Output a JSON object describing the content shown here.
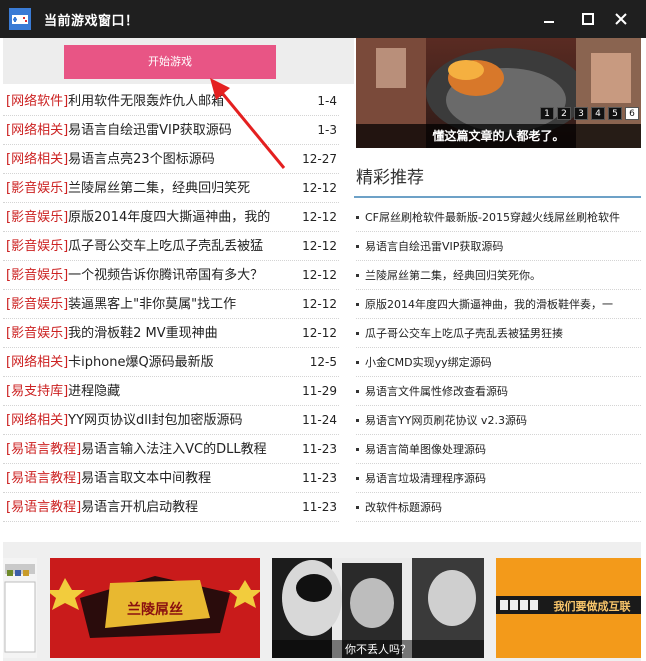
{
  "window": {
    "title": "当前游戏窗口！",
    "controls": {
      "minimize": "minimize",
      "maximize": "maximize",
      "close": "close"
    }
  },
  "start_button": {
    "label": "开始游戏"
  },
  "news": [
    {
      "tag": "[网络软件]",
      "title": "利用软件无限轰炸仇人邮箱",
      "date": "1-4"
    },
    {
      "tag": "[网络相关]",
      "title": "易语言自绘迅雷VIP获取源码",
      "date": "1-3"
    },
    {
      "tag": "[网络相关]",
      "title": "易语言点亮23个图标源码",
      "date": "12-27"
    },
    {
      "tag": "[影音娱乐]",
      "title": "兰陵屌丝第二集，经典回归笑死",
      "date": "12-12"
    },
    {
      "tag": "[影音娱乐]",
      "title": "原版2014年度四大撕逼神曲，我的",
      "date": "12-12"
    },
    {
      "tag": "[影音娱乐]",
      "title": "瓜子哥公交车上吃瓜子壳乱丢被猛",
      "date": "12-12"
    },
    {
      "tag": "[影音娱乐]",
      "title": "一个视频告诉你腾讯帝国有多大？",
      "date": "12-12"
    },
    {
      "tag": "[影音娱乐]",
      "title": "装逼黑客上\"非你莫属\"找工作",
      "date": "12-12"
    },
    {
      "tag": "[影音娱乐]",
      "title": "我的滑板鞋2 MV重现神曲",
      "date": "12-12"
    },
    {
      "tag": "[网络相关]",
      "title": "卡iphone爆Q源码最新版",
      "date": "12-5"
    },
    {
      "tag": "[易支持库]",
      "title": "进程隐藏",
      "date": "11-29"
    },
    {
      "tag": "[网络相关]",
      "title": "YY网页协议dll封包加密版源码",
      "date": "11-24"
    },
    {
      "tag": "[易语言教程]",
      "title": "易语言输入法注入VC的DLL教程",
      "date": "11-23"
    },
    {
      "tag": "[易语言教程]",
      "title": "易语言取文本中间教程",
      "date": "11-23"
    },
    {
      "tag": "[易语言教程]",
      "title": "易语言开机启动教程",
      "date": "11-23"
    }
  ],
  "banner": {
    "caption": "懂这篇文章的人都老了。",
    "pages": [
      "1",
      "2",
      "3",
      "4",
      "5",
      "6"
    ],
    "active_page": "6"
  },
  "recommend": {
    "title": "精彩推荐",
    "items": [
      "CF屌丝刷枪软件最新版-2015穿越火线屌丝刷枪软件",
      "易语言自绘迅雷VIP获取源码",
      "兰陵屌丝第二集，经典回归笑死你。",
      "原版2014年度四大撕逼神曲，我的滑板鞋伴奏，一",
      "瓜子哥公交车上吃瓜子壳乱丢被猛男狂揍",
      "小金CMD实现yy绑定源码",
      "易语言文件属性修改查看源码",
      "易语言YY网页刷花协议 v2.3源码",
      "易语言简单图像处理源码",
      "易语言垃圾清理程序源码",
      "改软件标题源码"
    ]
  },
  "thumbnails": {
    "t2_text": "兰陵屌丝",
    "t3_caption": "你不丢人吗？",
    "t4_text": "我们要做成互联"
  },
  "colors": {
    "titlebar": "#1f1f1f",
    "start_button": "#e85585",
    "tag_red": "#cc2222",
    "section_line": "#6da1c7"
  },
  "icons": [
    "game-controller-icon",
    "minimize-icon",
    "maximize-icon",
    "close-icon",
    "bullet-icon"
  ]
}
